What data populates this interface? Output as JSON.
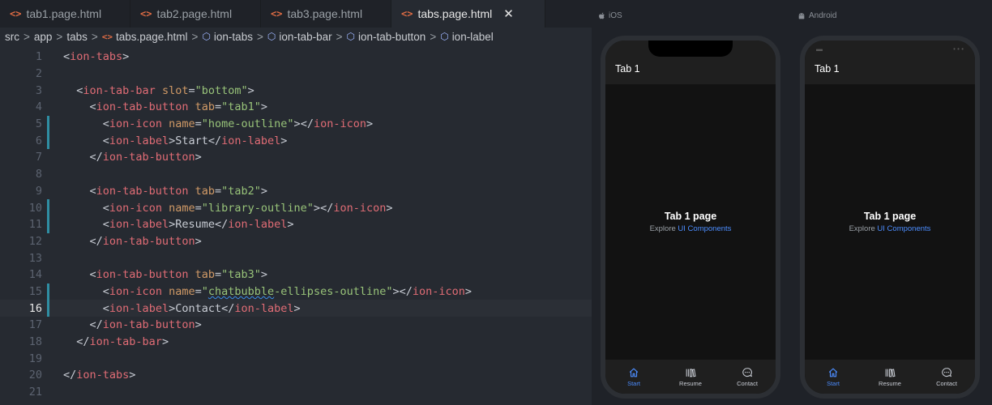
{
  "editor": {
    "tabs": [
      {
        "label": "tab1.page.html",
        "active": false
      },
      {
        "label": "tab2.page.html",
        "active": false
      },
      {
        "label": "tab3.page.html",
        "active": false
      },
      {
        "label": "tabs.page.html",
        "active": true
      }
    ],
    "close_glyph": "✕",
    "breadcrumb": {
      "folders": [
        "src",
        "app",
        "tabs"
      ],
      "file": "tabs.page.html",
      "symbols": [
        "ion-tabs",
        "ion-tab-bar",
        "ion-tab-button",
        "ion-label"
      ]
    },
    "lines": [
      {
        "n": "1",
        "t": "<ion-tabs>"
      },
      {
        "n": "2",
        "t": ""
      },
      {
        "n": "3",
        "t": "  <ion-tab-bar slot=\"bottom\">"
      },
      {
        "n": "4",
        "t": "    <ion-tab-button tab=\"tab1\">"
      },
      {
        "n": "5",
        "t": "      <ion-icon name=\"home-outline\"></ion-icon>"
      },
      {
        "n": "6",
        "t": "      <ion-label>Start</ion-label>"
      },
      {
        "n": "7",
        "t": "    </ion-tab-button>"
      },
      {
        "n": "8",
        "t": ""
      },
      {
        "n": "9",
        "t": "    <ion-tab-button tab=\"tab2\">"
      },
      {
        "n": "10",
        "t": "      <ion-icon name=\"library-outline\"></ion-icon>"
      },
      {
        "n": "11",
        "t": "      <ion-label>Resume</ion-label>"
      },
      {
        "n": "12",
        "t": "    </ion-tab-button>"
      },
      {
        "n": "13",
        "t": ""
      },
      {
        "n": "14",
        "t": "    <ion-tab-button tab=\"tab3\">"
      },
      {
        "n": "15",
        "t": "      <ion-icon name=\"chatbubble-ellipses-outline\"></ion-icon>"
      },
      {
        "n": "16",
        "t": "      <ion-label>Contact</ion-label>"
      },
      {
        "n": "17",
        "t": "    </ion-tab-button>"
      },
      {
        "n": "18",
        "t": "  </ion-tab-bar>"
      },
      {
        "n": "19",
        "t": ""
      },
      {
        "n": "20",
        "t": "</ion-tabs>"
      },
      {
        "n": "21",
        "t": ""
      }
    ],
    "modified_lines": [
      "5",
      "6",
      "10",
      "11",
      "15",
      "16"
    ],
    "current_line": "16",
    "colors": {
      "tag": "#e06c75",
      "attr": "#d19a66",
      "string": "#98c379",
      "git_marker": "#2f8ea3"
    }
  },
  "preview": {
    "devices": [
      {
        "platform": "iOS",
        "platform_icon": "apple-icon",
        "toolbar_title": "Tab 1",
        "page_title": "Tab 1 page",
        "explore_text": "Explore",
        "link_text": "UI Components",
        "tabs": [
          {
            "label": "Start",
            "icon": "home-outline-icon",
            "active": true
          },
          {
            "label": "Resume",
            "icon": "library-outline-icon",
            "active": false
          },
          {
            "label": "Contact",
            "icon": "chatbubble-ellipses-icon",
            "active": false
          }
        ]
      },
      {
        "platform": "Android",
        "platform_icon": "android-icon",
        "toolbar_title": "Tab 1",
        "page_title": "Tab 1 page",
        "explore_text": "Explore",
        "link_text": "UI Components",
        "tabs": [
          {
            "label": "Start",
            "icon": "home-outline-icon",
            "active": true
          },
          {
            "label": "Resume",
            "icon": "library-outline-icon",
            "active": false
          },
          {
            "label": "Contact",
            "icon": "chatbubble-ellipses-icon",
            "active": false
          }
        ]
      }
    ],
    "accent": "#4c8dff"
  }
}
